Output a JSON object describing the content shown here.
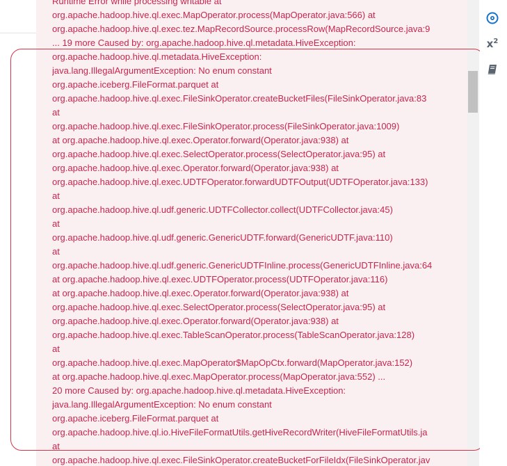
{
  "code_block": {
    "lines": [
      "Runtime Error while processing writable at",
      "org.apache.hadoop.hive.ql.exec.MapOperator.process(MapOperator.java:566) at",
      "org.apache.hadoop.hive.ql.exec.tez.MapRecordSource.processRow(MapRecordSource.java:9",
      "... 19 more Caused by: org.apache.hadoop.hive.ql.metadata.HiveException:",
      "org.apache.hadoop.hive.ql.metadata.HiveException:",
      "java.lang.IllegalArgumentException: No enum constant",
      "org.apache.iceberg.FileFormat.parquet at",
      "org.apache.hadoop.hive.ql.exec.FileSinkOperator.createBucketFiles(FileSinkOperator.java:83",
      "at",
      "org.apache.hadoop.hive.ql.exec.FileSinkOperator.process(FileSinkOperator.java:1009)",
      "at org.apache.hadoop.hive.ql.exec.Operator.forward(Operator.java:938) at",
      "org.apache.hadoop.hive.ql.exec.SelectOperator.process(SelectOperator.java:95) at",
      "org.apache.hadoop.hive.ql.exec.Operator.forward(Operator.java:938) at",
      "org.apache.hadoop.hive.ql.exec.UDTFOperator.forwardUDTFOutput(UDTFOperator.java:133)",
      "at",
      "org.apache.hadoop.hive.ql.udf.generic.UDTFCollector.collect(UDTFCollector.java:45)",
      "at",
      "org.apache.hadoop.hive.ql.udf.generic.GenericUDTF.forward(GenericUDTF.java:110)",
      "at",
      "org.apache.hadoop.hive.ql.udf.generic.GenericUDTFInline.process(GenericUDTFInline.java:64",
      "at org.apache.hadoop.hive.ql.exec.UDTFOperator.process(UDTFOperator.java:116)",
      "at org.apache.hadoop.hive.ql.exec.Operator.forward(Operator.java:938) at",
      "org.apache.hadoop.hive.ql.exec.SelectOperator.process(SelectOperator.java:95) at",
      "org.apache.hadoop.hive.ql.exec.Operator.forward(Operator.java:938) at",
      "org.apache.hadoop.hive.ql.exec.TableScanOperator.process(TableScanOperator.java:128)",
      "at",
      "org.apache.hadoop.hive.ql.exec.MapOperator$MapOpCtx.forward(MapOperator.java:152)",
      "at org.apache.hadoop.hive.ql.exec.MapOperator.process(MapOperator.java:552) ...",
      "20 more Caused by: org.apache.hadoop.hive.ql.metadata.HiveException:",
      "java.lang.IllegalArgumentException: No enum constant",
      "org.apache.iceberg.FileFormat.parquet at",
      "org.apache.hadoop.hive.ql.io.HiveFileFormatUtils.getHiveRecordWriter(HiveFileFormatUtils.ja",
      "at",
      "org.apache.hadoop.hive.ql.exec.FileSinkOperator.createBucketForFileIdx(FileSinkOperator.jav"
    ]
  },
  "rail": {
    "icons": [
      {
        "name": "compass-icon",
        "color": "#1a73c8"
      },
      {
        "name": "superscript-icon",
        "label": "x",
        "sup": "2"
      },
      {
        "name": "book-icon",
        "color": "#5a6370"
      }
    ]
  },
  "colors": {
    "code_text": "#c7254e",
    "code_background": "#fbf0f1",
    "highlight_border": "#d9334a"
  }
}
